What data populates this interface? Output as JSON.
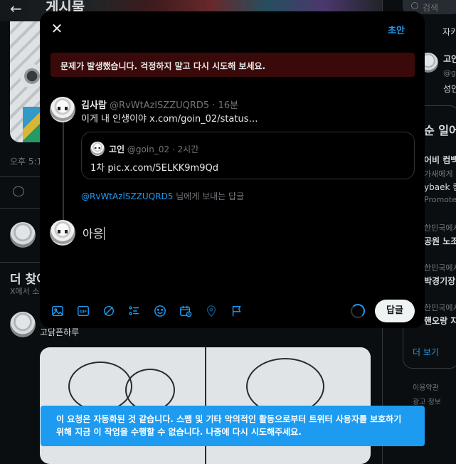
{
  "background": {
    "header_title": "게시물",
    "timestamp_partial": "오후 5:1",
    "more_title": "더 찾아",
    "more_sub": "X에서 소",
    "suggested_user_name": "고닭픈하루"
  },
  "right_column": {
    "search_placeholder": "검색",
    "tab_partial": "자키",
    "user_name_partial": "고인",
    "user_handle_partial": "@g",
    "user_bio_partial": "성인",
    "section_title_partial": "순 일어",
    "trends": [
      {
        "sub": "",
        "title": "어비 컴백"
      },
      {
        "sub": "가새에게",
        "title": "ybaek 컴"
      },
      {
        "sub": "Promote",
        "title": ""
      },
      {
        "sub": "한민국에서",
        "title": "공원 노조"
      },
      {
        "sub": "한민국에서",
        "title": "박경기장"
      },
      {
        "sub": "한민국에서",
        "title": "핸오랑 지"
      }
    ],
    "show_more": "더 보기",
    "footer": [
      "이용약관",
      "광고 정보"
    ]
  },
  "modal": {
    "close_icon": "close-icon",
    "draft_label": "초안",
    "error_message": "문제가 발생했습니다. 걱정하지 말고 다시 시도해 보세요.",
    "tweet": {
      "name": "김사람",
      "handle": "@RvWtAzlSZZUQRD5",
      "time": "· 16분",
      "body": "이게 내 인생이야 x.com/goin_02/status…"
    },
    "quote": {
      "name": "고인",
      "handle": "@goin_02",
      "time": "· 2시간",
      "body": "1차 pic.x.com/5ELKK9m9Qd"
    },
    "replying_handle": "@RvWtAzlSZZUQRD5",
    "replying_suffix": " 님에게 보내는 답글",
    "compose_text": "아응",
    "toolbar_icons": [
      "image-icon",
      "gif-icon",
      "grok-icon",
      "poll-icon",
      "emoji-icon",
      "schedule-icon",
      "location-icon",
      "flag-icon"
    ],
    "reply_button": "답글"
  },
  "toast": {
    "message": "이 요청은 자동화된 것 같습니다. 스팸 및 기타 악의적인 활동으로부터 트위터 사용자를 보호하기 위해 지금 이 작업을 수행할 수 없습니다. 나중에 다시 시도해주세요."
  },
  "colors": {
    "accent": "#1d9bf0",
    "error_banner": "#3a0a0a",
    "background": "#000000"
  }
}
